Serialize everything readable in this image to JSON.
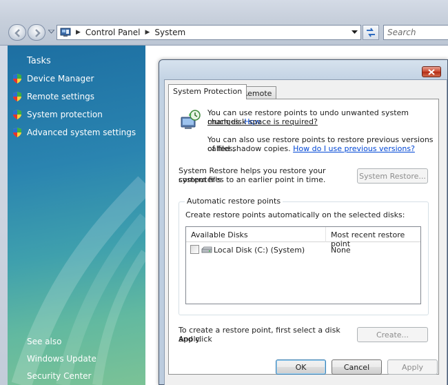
{
  "address_bar": {
    "crumbs": [
      "Control Panel",
      "System"
    ],
    "search_placeholder": "Search"
  },
  "tasks_pane": {
    "title": "Tasks",
    "items": [
      {
        "label": "Device Manager",
        "icon": "shield-icon"
      },
      {
        "label": "Remote settings",
        "icon": "shield-icon"
      },
      {
        "label": "System protection",
        "icon": "shield-icon"
      },
      {
        "label": "Advanced system settings",
        "icon": "shield-icon"
      }
    ],
    "see_also": {
      "title": "See also",
      "items": [
        "Windows Update",
        "Security Center"
      ]
    }
  },
  "dialog": {
    "tabs": [
      "System Protection",
      "Remote"
    ],
    "active_tab": "System Protection",
    "intro_text": "You can use restore points to undo unwanted system changes.",
    "intro_link_a": "How",
    "intro_link_b": "much disk space is required?",
    "shadow_text_a": "You can also use restore points to restore previous versions of files,",
    "shadow_text_b": "called shadow copies.",
    "shadow_link": "How do I use previous versions?",
    "restore_text_a": "System Restore helps you restore your computer's",
    "restore_text_b": "system files to an earlier point in time.",
    "restore_button": "System Restore...",
    "group_title": "Automatic restore points",
    "group_text": "Create restore points automatically on the selected disks:",
    "disks_table": {
      "columns": [
        "Available Disks",
        "Most recent restore point"
      ],
      "rows": [
        {
          "disk": "Local Disk (C:) (System)",
          "restore_point": "None",
          "checked": false
        }
      ]
    },
    "create_text_a": "To create a restore point, first select a disk and click",
    "create_text_b": "Apply.",
    "create_button": "Create...",
    "ok_button": "OK",
    "cancel_button": "Cancel",
    "apply_button": "Apply"
  },
  "colors": {
    "accent": "#0046d5",
    "tasks_top": "#1d6fa2",
    "tasks_bottom": "#7bc296",
    "close_button": "#c9482e"
  }
}
